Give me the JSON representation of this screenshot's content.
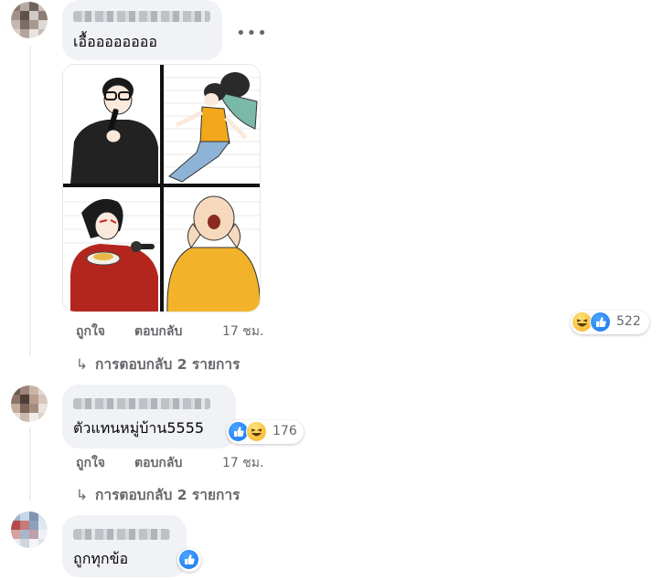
{
  "comments": [
    {
      "text": "เอื้ออออออออ",
      "more_label": "•••",
      "actions": {
        "like": "ถูกใจ",
        "reply": "ตอบกลับ",
        "time": "17 ชม."
      },
      "reactions": {
        "icons": [
          "haha-icon",
          "like-icon"
        ],
        "count": "522"
      },
      "replies_label": "การตอบกลับ 2 รายการ"
    },
    {
      "text": "ตัวแทนหมู่บ้าน5555",
      "actions": {
        "like": "ถูกใจ",
        "reply": "ตอบกลับ",
        "time": "17 ชม."
      },
      "reactions": {
        "icons": [
          "like-icon",
          "haha-icon"
        ],
        "count": "176"
      },
      "replies_label": "การตอบกลับ 2 รายการ"
    },
    {
      "text": "ถูกทุกข้อ",
      "reactions": {
        "icons": [
          "like-icon"
        ]
      }
    }
  ],
  "colors": {
    "bubble": "#f0f2f5",
    "meta": "#65676b",
    "like": "#1877f2",
    "haha": "#f7b125"
  }
}
